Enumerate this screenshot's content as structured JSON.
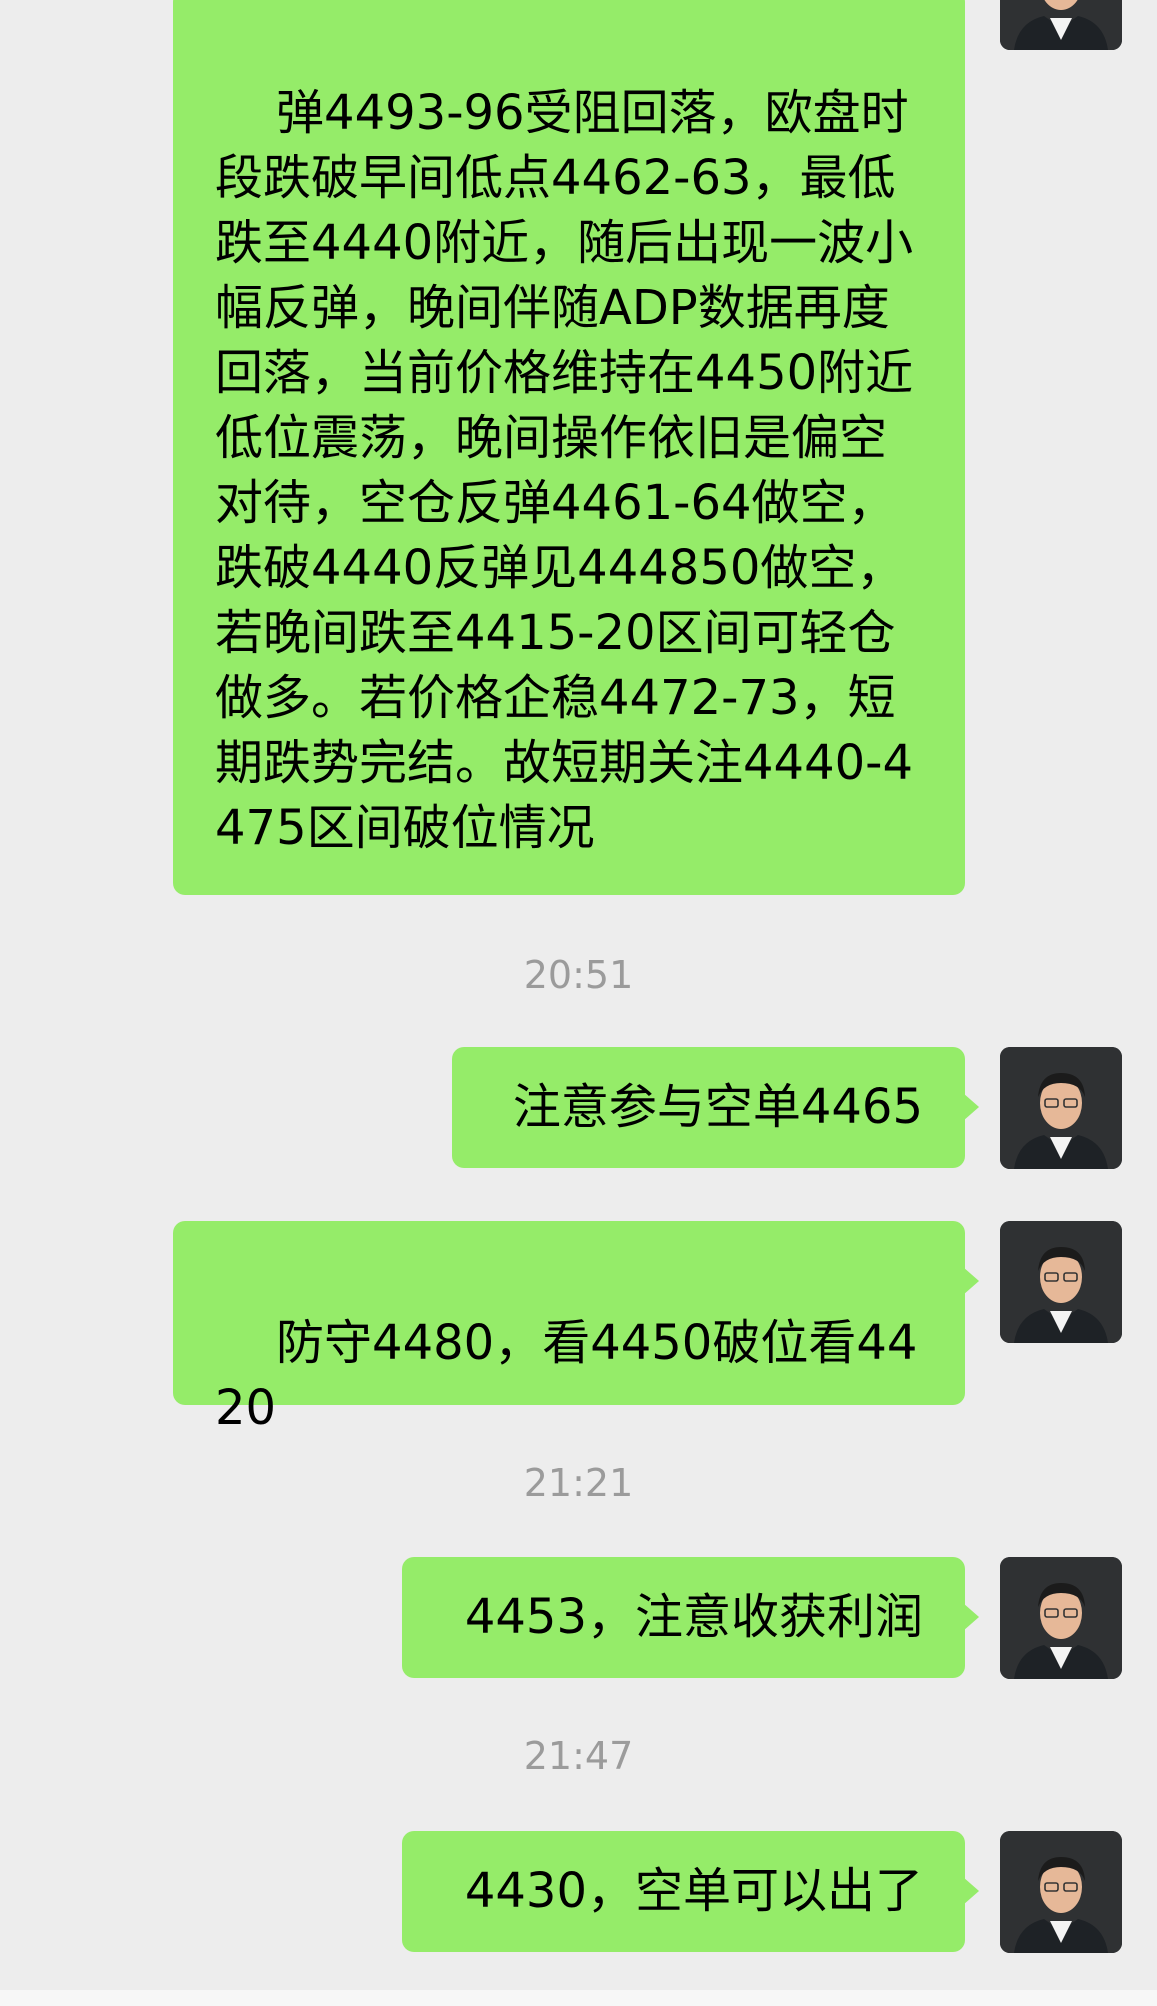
{
  "messages": [
    {
      "text": "弹4493-96受阻回落，欧盘时段跌破早间低点4462-63，最低跌至4440附近，随后出现一波小幅反弹，晚间伴随ADP数据再度回落，当前价格维持在4450附近低位震荡，晚间操作依旧是偏空对待，空仓反弹4461-64做空，跌破4440反弹见444850做空，若晚间跌至4415-20区间可轻仓做多。若价格企稳4472-73，短期跌势完结。故短期关注4440-4475区间破位情况"
    },
    {
      "text": "注意参与空单4465"
    },
    {
      "text": "防守4480，看4450破位看4420"
    },
    {
      "text": "4453，注意收获利润"
    },
    {
      "text": "4430，空单可以出了"
    }
  ],
  "timestamps": [
    "20:51",
    "21:21",
    "21:47"
  ],
  "colors": {
    "background": "#ededed",
    "bubble": "#95ec69",
    "timestamp": "#9b9b9b"
  },
  "icons": {
    "avatar": "avatar-icon"
  }
}
